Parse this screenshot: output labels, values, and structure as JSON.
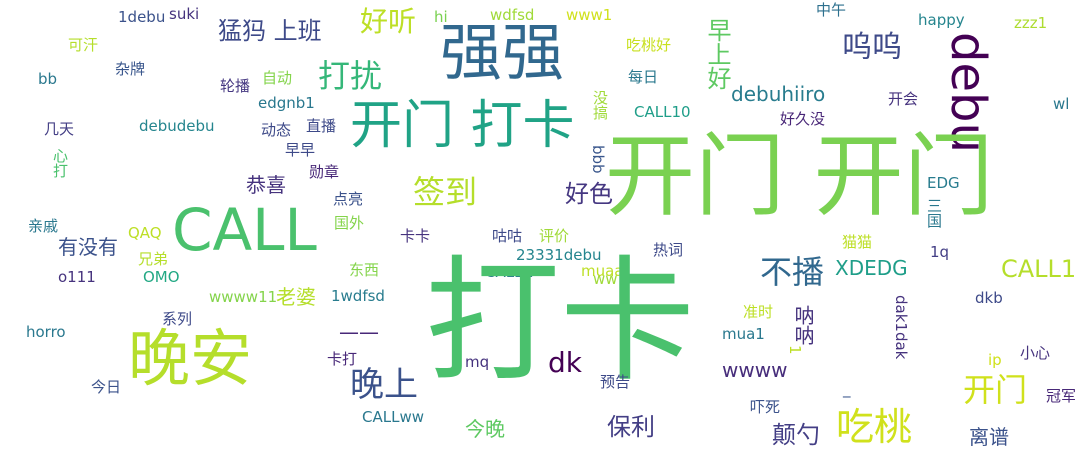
{
  "words": {
    "w1debu": "1debu",
    "suki": "suki",
    "hi": "hi",
    "wdfsd": "wdfsd",
    "www1": "www1",
    "zhongwu": "中午",
    "happy": "happy",
    "zzz1": "zzz1",
    "kehan": "可汗",
    "mengma": "猛犸 上班",
    "haoting": "好听",
    "chitaohao": "吃桃好",
    "qiangqiang": "强强",
    "zaoshanghao": "早上好",
    "wuwu": "呜呜",
    "debu": "debu",
    "bb": "bb",
    "zapai": "杂牌",
    "dazao": "打扰",
    "meiri": "每日",
    "lunbo": "轮播",
    "zidong": "自动",
    "mei_xian": "没搞",
    "debuhiiro": "debuhiiro",
    "edgnb1": "edgnb1",
    "kaihui": "开会",
    "wl": "wl",
    "kaimendaka": "开门 打卡",
    "jitian": "几天",
    "debudebu": "debudebu",
    "dongtai": "动态",
    "zhibo": "直播",
    "call10": "CALL10",
    "haojiumei": "好久没",
    "xinda": "心打",
    "zaozao": "早早",
    "bbb": "bbb",
    "kaimenkaimen": "开门 开门",
    "gongxi": "恭喜",
    "xunzhang": "勋章",
    "edg": "EDG",
    "qiandao": "签到",
    "haose": "好色",
    "dianliang": "点亮",
    "sanjun": "三国",
    "qinqi": "亲戚",
    "call": "CALL",
    "guowai": "国外",
    "qaq": "QAQ",
    "kaka": "卡卡",
    "gugu": "咕咕",
    "pingjia": "评价",
    "youmeiyou": "有没有",
    "maomao": "猫猫",
    "xiongdi": "兄弟",
    "reci": "热词",
    "q1": "1q",
    "o111": "o111",
    "omo": "OMO",
    "dongxi": "东西",
    "debu23331": "23331debu",
    "bubo": "不播",
    "xdedg": "XDEDG",
    "callw": "CALLw",
    "muaa": "muaa",
    "call1": "CALL1",
    "ww": "ww",
    "wwww11": "wwww11",
    "laopo": "老婆",
    "wdfsd1": "1wdfsd",
    "dkb": "dkb",
    "daka": "打卡",
    "xilie": "系列",
    "horro": "horro",
    "wanan": "晚安",
    "dash": "——",
    "zhunshi": "准时",
    "nana": "呐呐",
    "dak1dak": "dak1dak",
    "mua1": "mua1",
    "kada": "卡打",
    "dk": "dk",
    "one": "1",
    "ip": "ip",
    "xiaoxin": "小心",
    "wanshang": "晚上",
    "mq": "mq",
    "wwww": "wwww",
    "jinri": "今日",
    "yugao": "预告",
    "kaimen": "开门",
    "guanjun": "冠军",
    "underscore": "_",
    "baoli": "保利",
    "xiasi": "吓死",
    "callww": "CALLww",
    "jinwan": "今晚",
    "dianshao": "颠勺",
    "chitao": "吃桃",
    "lipu": "离谱"
  }
}
